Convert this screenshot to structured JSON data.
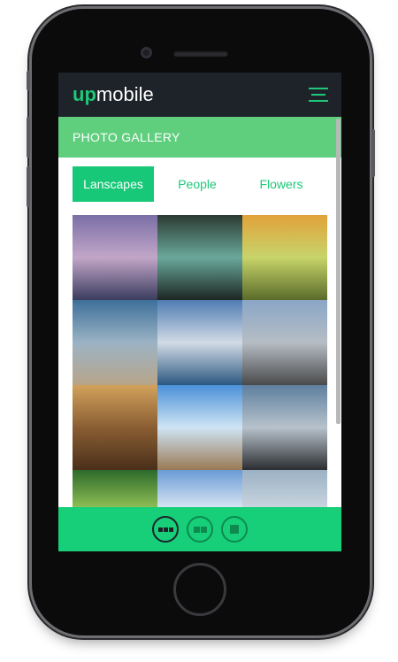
{
  "app": {
    "logo_bold": "up",
    "logo_regular": "mobile"
  },
  "header": {
    "title": "PHOTO GALLERY"
  },
  "tabs": [
    {
      "label": "Lanscapes",
      "active": true
    },
    {
      "label": "People",
      "active": false
    },
    {
      "label": "Flowers",
      "active": false
    }
  ],
  "gallery": {
    "photos": [
      {
        "name": "volcano-sunset",
        "colors": [
          "#7a6fa6",
          "#c2a6c8",
          "#3a3c5e"
        ]
      },
      {
        "name": "green-scooter",
        "colors": [
          "#2b3b33",
          "#6aa89a",
          "#1c2622"
        ]
      },
      {
        "name": "yellow-tulip",
        "colors": [
          "#e2a23a",
          "#c7d46a",
          "#5a6b2a"
        ]
      },
      {
        "name": "beach-shore",
        "colors": [
          "#3d6f9a",
          "#9bb3c4",
          "#b7a58a"
        ]
      },
      {
        "name": "mountain-lake",
        "colors": [
          "#4f7cb3",
          "#d2dbe6",
          "#2c5880"
        ]
      },
      {
        "name": "desert-road",
        "colors": [
          "#8aa6c7",
          "#b5bdc4",
          "#4a4a4a"
        ]
      },
      {
        "name": "dusty-jeep",
        "colors": [
          "#d2a25c",
          "#8a5e33",
          "#4a2f1a"
        ]
      },
      {
        "name": "wooden-pier",
        "colors": [
          "#4a90d8",
          "#cfe4f4",
          "#9a7a55"
        ]
      },
      {
        "name": "plane-wreck",
        "colors": [
          "#5d7f9e",
          "#b7c2cc",
          "#2b2d30"
        ]
      },
      {
        "name": "forest-path",
        "colors": [
          "#2d6a2b",
          "#9bc95a",
          "#1b3a1a"
        ]
      },
      {
        "name": "cloudy-sky",
        "colors": [
          "#6a9bd6",
          "#e6eef6",
          "#ffffff"
        ]
      },
      {
        "name": "hazy-hills",
        "colors": [
          "#9bb1c4",
          "#cfd9e2",
          "#6a7a82"
        ]
      }
    ]
  },
  "view_modes": [
    {
      "name": "grid-3-view",
      "active": true
    },
    {
      "name": "grid-2-view",
      "active": false
    },
    {
      "name": "grid-1-view",
      "active": false
    }
  ],
  "colors": {
    "accent": "#16c877",
    "header_bg": "#1e2229",
    "title_bg": "#5fcf7e"
  }
}
